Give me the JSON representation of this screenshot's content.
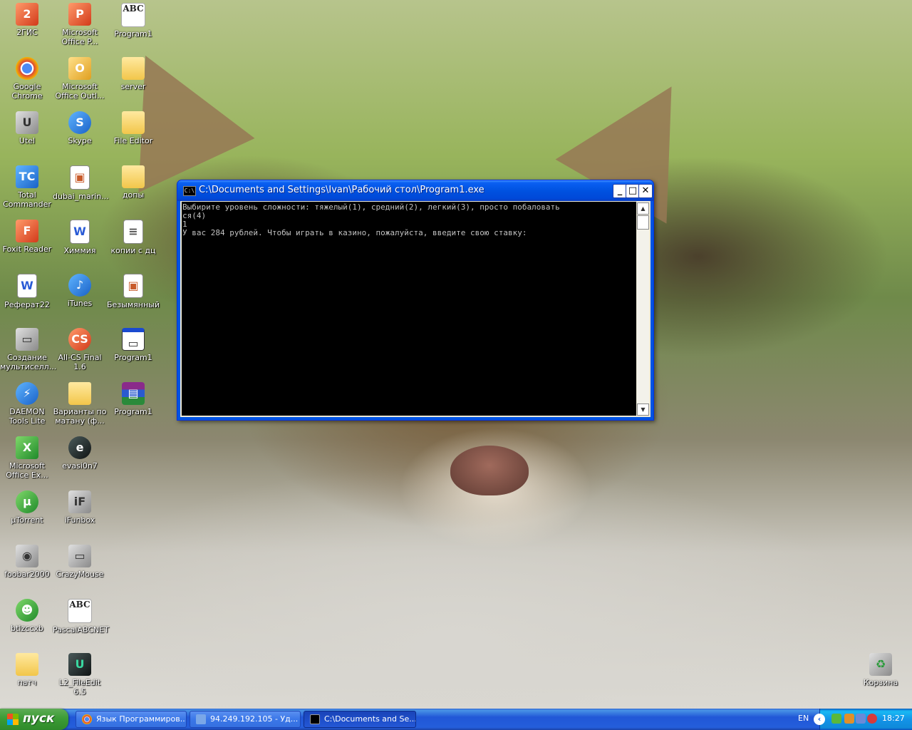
{
  "desktop": {
    "icons": [
      {
        "label": "2ГИС",
        "glyph": "2"
      },
      {
        "label": "Microsoft Office P...",
        "glyph": "P"
      },
      {
        "label": "Program1",
        "glyph": "ABC"
      },
      {
        "label": "Google Chrome",
        "glyph": "●"
      },
      {
        "label": "Microsoft Office Outl...",
        "glyph": "O"
      },
      {
        "label": "server",
        "glyph": ""
      },
      {
        "label": "Utel",
        "glyph": "U"
      },
      {
        "label": "Skype",
        "glyph": "S"
      },
      {
        "label": "File Editor",
        "glyph": ""
      },
      {
        "label": "Total Commander",
        "glyph": "TC"
      },
      {
        "label": "dubai_marin...",
        "glyph": "▣"
      },
      {
        "label": "допы",
        "glyph": ""
      },
      {
        "label": "Foxit Reader",
        "glyph": "F"
      },
      {
        "label": "Химмия",
        "glyph": "W"
      },
      {
        "label": "копии с дц",
        "glyph": "≡"
      },
      {
        "label": "Реферат22",
        "glyph": "W"
      },
      {
        "label": "iTunes",
        "glyph": "♪"
      },
      {
        "label": "Безымянный",
        "glyph": "▣"
      },
      {
        "label": "Создание мультиселл...",
        "glyph": "▭"
      },
      {
        "label": "All-CS Final 1.6",
        "glyph": "CS"
      },
      {
        "label": "Program1",
        "glyph": "▭"
      },
      {
        "label": "DAEMON Tools Lite",
        "glyph": "⚡"
      },
      {
        "label": "Варианты по матану (ф...",
        "glyph": ""
      },
      {
        "label": "Program1",
        "glyph": "▤"
      },
      {
        "label": "Microsoft Office Ex...",
        "glyph": "X"
      },
      {
        "label": "evasi0n7",
        "glyph": "e"
      },
      {
        "label": "µTorrent",
        "glyph": "µ"
      },
      {
        "label": "iFunbox",
        "glyph": "iF"
      },
      {
        "label": "foobar2000",
        "glyph": "◉"
      },
      {
        "label": "CrazyMouse",
        "glyph": "▭"
      },
      {
        "label": "btlzccxb",
        "glyph": "☻"
      },
      {
        "label": "PascalABCNET",
        "glyph": "ABC"
      },
      {
        "label": "патч",
        "glyph": ""
      },
      {
        "label": "L2_FileEdit 6.5",
        "glyph": "U"
      },
      {
        "label": "Корзина",
        "glyph": "♻"
      }
    ]
  },
  "console": {
    "title": "C:\\Documents and Settings\\Ivan\\Рабочий стол\\Program1.exe",
    "icon_text": "C:\\",
    "minimize": "_",
    "maximize": "□",
    "close": "✕",
    "lines": [
      "Выбирите уровень сложности: тяжелый(1), средний(2), легкий(3), просто побаловать",
      "ся(4)",
      "1",
      "У вас 284 рублей. Чтобы играть в казино, пожалуйста, введите свою ставку:"
    ],
    "scroll_up": "▲",
    "scroll_down": "▼"
  },
  "taskbar": {
    "start_label": "пуск",
    "tasks": [
      {
        "label": "Язык Программиров...",
        "icon_color": "#e8453c"
      },
      {
        "label": "94.249.192.105 - Уд...",
        "icon_color": "#7aa7e8"
      },
      {
        "label": "C:\\Documents and Se...",
        "icon_color": "#000000"
      }
    ],
    "language": "EN",
    "tray_toggle": "‹",
    "clock": "18:27"
  },
  "colors": {
    "title_bar": "#0054e3",
    "taskbar": "#245edb",
    "start_button": "#3c9c35",
    "console_bg": "#000000",
    "console_text": "#c0c0c0"
  }
}
